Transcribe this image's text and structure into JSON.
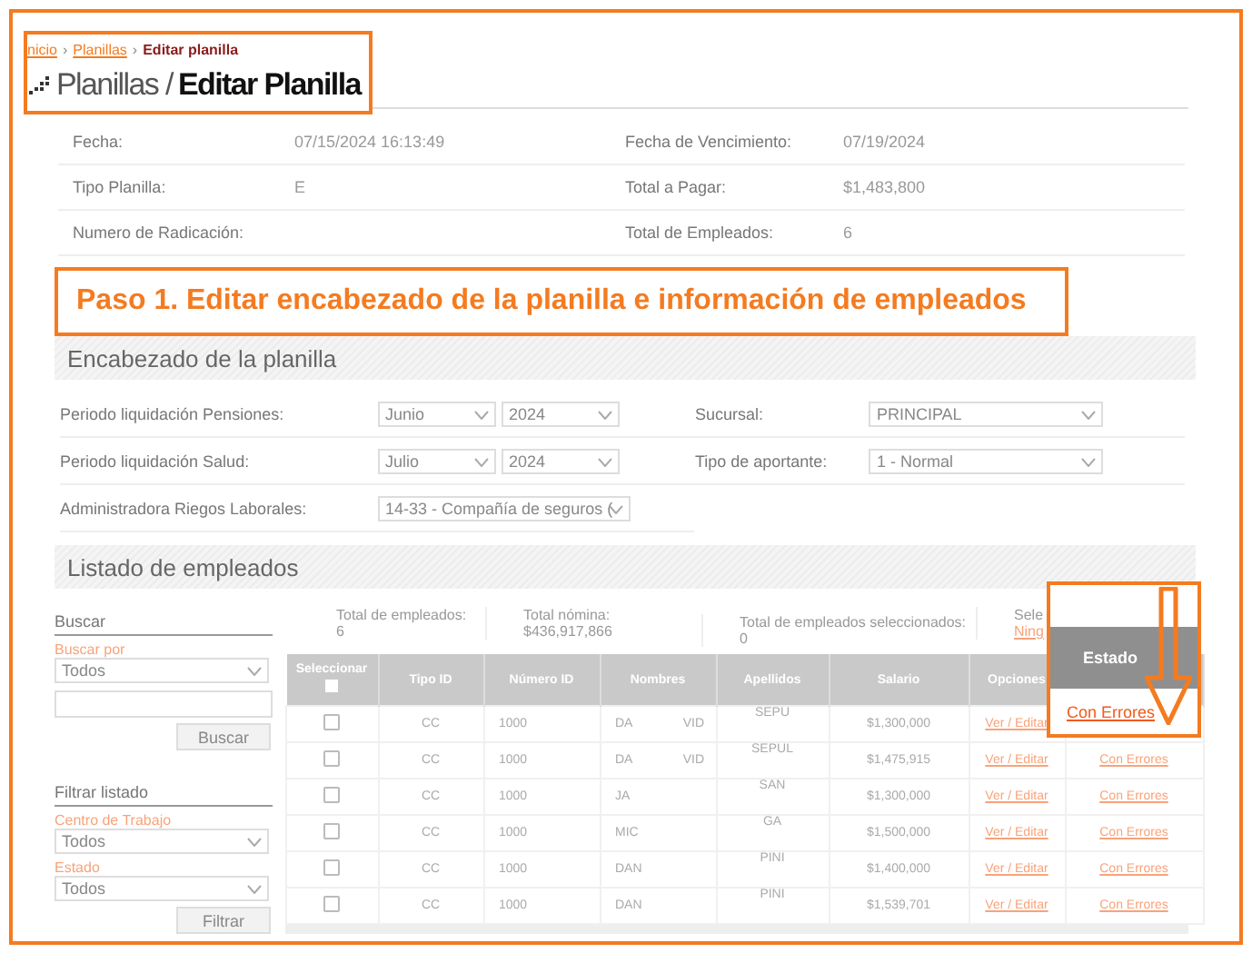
{
  "breadcrumb": {
    "separator": "›",
    "items": [
      {
        "label": "nicio",
        "kind": "link"
      },
      {
        "label": "Planillas",
        "kind": "link"
      },
      {
        "label": "Editar planilla",
        "kind": "current"
      }
    ]
  },
  "title": {
    "section": "Planillas /",
    "page": "Editar Planilla"
  },
  "info": [
    {
      "label": "Fecha:",
      "value": "07/15/2024 16:13:49",
      "label_2": "Fecha de Vencimiento:",
      "value_2": "07/19/2024"
    },
    {
      "label": "Tipo Planilla:",
      "value": "E",
      "label_2": "Total a Pagar:",
      "value_2": "$1,483,800"
    },
    {
      "label": "Numero de Radicación:",
      "label_2": "Total de Empleados:",
      "value_2": "6"
    }
  ],
  "step_callout": "Paso 1. Editar encabezado de la planilla e información de empleados",
  "header_section": {
    "title": "Encabezado de la planilla",
    "left": [
      {
        "label": "Periodo liquidación Pensiones:",
        "selects": [
          "Junio",
          "2024"
        ]
      },
      {
        "label": "Periodo liquidación Salud:",
        "selects": [
          "Julio",
          "2024"
        ]
      },
      {
        "label": "Administradora Riegos Laborales:",
        "selects": [
          "14-33 - Compañía de seguros ("
        ]
      }
    ],
    "right": [
      {
        "label": "Sucursal:",
        "select": "PRINCIPAL"
      },
      {
        "label": "Tipo de aportante:",
        "select": "1 - Normal"
      }
    ]
  },
  "employees_section": {
    "title": "Listado de empleados",
    "search": {
      "title": "Buscar",
      "field_label": "Buscar por",
      "select": "Todos",
      "button": "Buscar"
    },
    "filter": {
      "title": "Filtrar listado",
      "fields": [
        {
          "label": "Centro de Trabajo",
          "select": "Todos"
        },
        {
          "label": "Estado",
          "select": "Todos"
        }
      ],
      "button": "Filtrar"
    },
    "summary": [
      {
        "label": "Total de empleados:",
        "value": "6"
      },
      {
        "label": "Total nómina:",
        "value": "$436,917,866"
      },
      {
        "label": "Total de empleados seleccionados: 0"
      },
      {
        "label": "Sele",
        "link": "Ning"
      }
    ],
    "table": {
      "select_header": "Seleccionar",
      "select_all_checked": false,
      "columns": [
        "Tipo ID",
        "Número ID",
        "Nombres",
        "Apellidos",
        "Salario",
        "Opciones"
      ],
      "rows": [
        {
          "checked": false,
          "tipo": "CC",
          "numero": "1000",
          "nombres": [
            "DA",
            "VID"
          ],
          "apellidos": "SEPU",
          "salario": "$1,300,000",
          "opciones": "Ver / Editar"
        },
        {
          "checked": false,
          "tipo": "CC",
          "numero": "1000",
          "nombres": [
            "DA",
            "VID"
          ],
          "apellidos": "SEPUL",
          "salario": "$1,475,915",
          "opciones": "Ver / Editar",
          "estado": "Con Errores"
        },
        {
          "checked": false,
          "tipo": "CC",
          "numero": "1000",
          "nombres": [
            "JA"
          ],
          "apellidos": "SAN",
          "salario": "$1,300,000",
          "opciones": "Ver / Editar",
          "estado": "Con Errores"
        },
        {
          "checked": false,
          "tipo": "CC",
          "numero": "1000",
          "nombres": [
            "MIC"
          ],
          "apellidos": "GA",
          "salario": "$1,500,000",
          "opciones": "Ver / Editar",
          "estado": "Con Errores"
        },
        {
          "checked": false,
          "tipo": "CC",
          "numero": "1000",
          "nombres": [
            "DAN"
          ],
          "apellidos": "PINI",
          "salario": "$1,400,000",
          "opciones": "Ver / Editar",
          "estado": "Con Errores"
        },
        {
          "checked": false,
          "tipo": "CC",
          "numero": "1000",
          "nombres": [
            "DAN"
          ],
          "apellidos": "PINI",
          "salario": "$1,539,701",
          "opciones": "Ver / Editar",
          "estado": "Con Errores"
        }
      ]
    },
    "estado_callout": {
      "header": "Estado",
      "value": "Con Errores"
    }
  }
}
